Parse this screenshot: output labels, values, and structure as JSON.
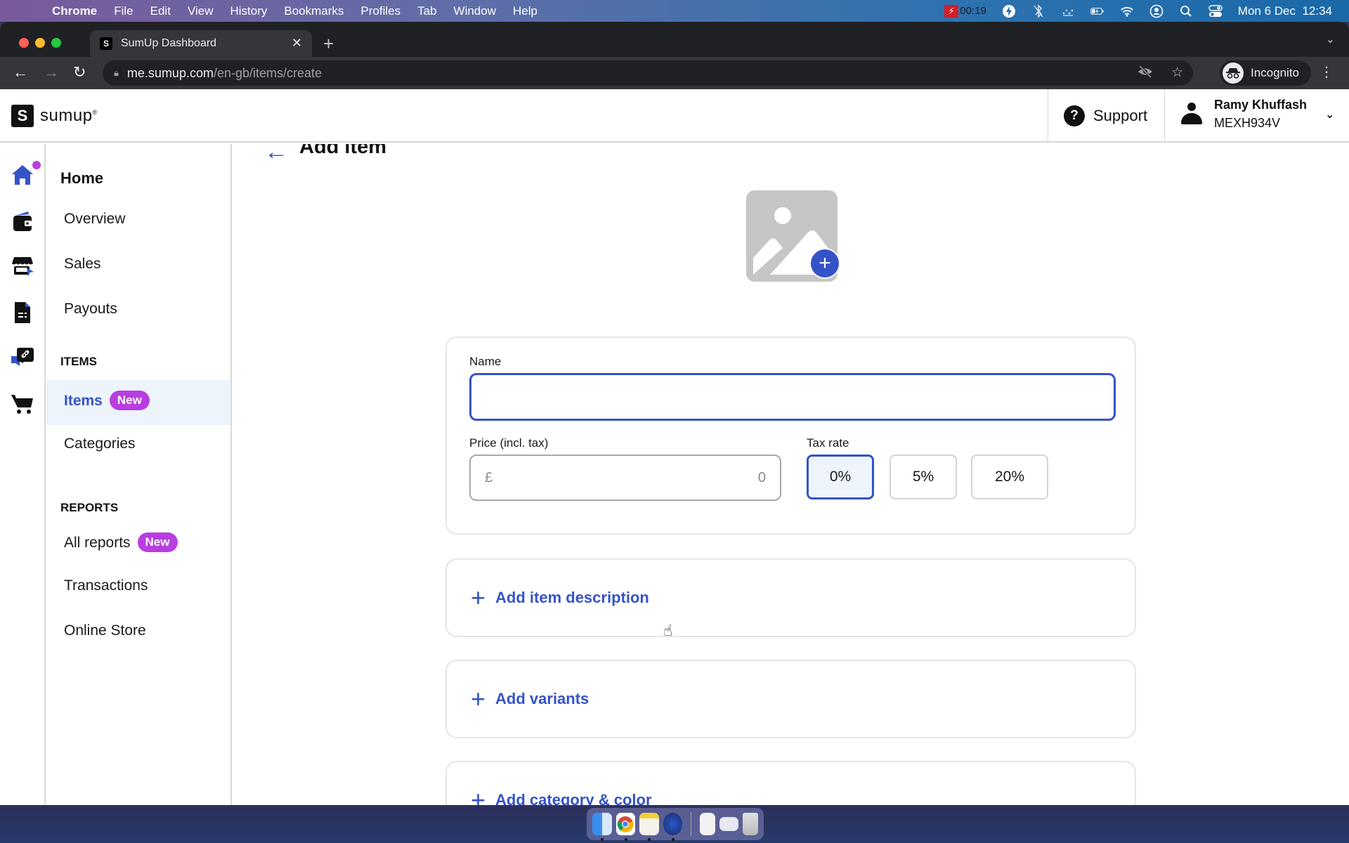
{
  "menubar": {
    "app_name": "Chrome",
    "menus": [
      "File",
      "Edit",
      "View",
      "History",
      "Bookmarks",
      "Profiles",
      "Tab",
      "Window",
      "Help"
    ],
    "recording_time": "00:19",
    "datetime": "Mon 6 Dec  12:34",
    "tray_icons": [
      "flash-icon",
      "bluetooth-icon",
      "dotted-icon",
      "battery-charging-icon",
      "wifi-icon",
      "user-circle-icon",
      "search-icon",
      "control-center-icon"
    ]
  },
  "browser": {
    "tab_title": "SumUp Dashboard",
    "url_host": "me.sumup.com",
    "url_path": "/en-gb/items/create",
    "profile_label": "Incognito"
  },
  "header": {
    "logo_text": "sumup",
    "support_label": "Support",
    "user_name": "Ramy Khuffash",
    "merchant_id": "MEXH934V"
  },
  "rail": {
    "icons": [
      "home-icon",
      "wallet-icon",
      "store-icon",
      "invoice-icon",
      "payment-link-icon",
      "cart-icon"
    ]
  },
  "nav": {
    "home_label": "Home",
    "home_items": [
      "Overview",
      "Sales",
      "Payouts"
    ],
    "items_section": "ITEMS",
    "items_active": "Items",
    "new_badge": "New",
    "categories": "Categories",
    "reports_section": "REPORTS",
    "all_reports": "All reports",
    "transactions": "Transactions",
    "online_store": "Online Store"
  },
  "form": {
    "title": "Add item",
    "name_label": "Name",
    "name_value": "",
    "price_label": "Price (incl. tax)",
    "currency_symbol": "£",
    "price_placeholder": "0",
    "tax_label": "Tax rate",
    "tax_options": [
      "0%",
      "5%",
      "20%"
    ],
    "tax_selected": "0%",
    "add_description": "Add item description",
    "add_variants": "Add variants",
    "add_category": "Add category & color"
  },
  "colors": {
    "accent": "#3553c8",
    "badge": "#b83ee0",
    "active_bg": "#edf4fc"
  },
  "dock": {
    "apps": [
      "Finder",
      "Chrome",
      "Notes",
      "Reeder",
      "Document",
      "Screenshot",
      "Trash"
    ]
  }
}
